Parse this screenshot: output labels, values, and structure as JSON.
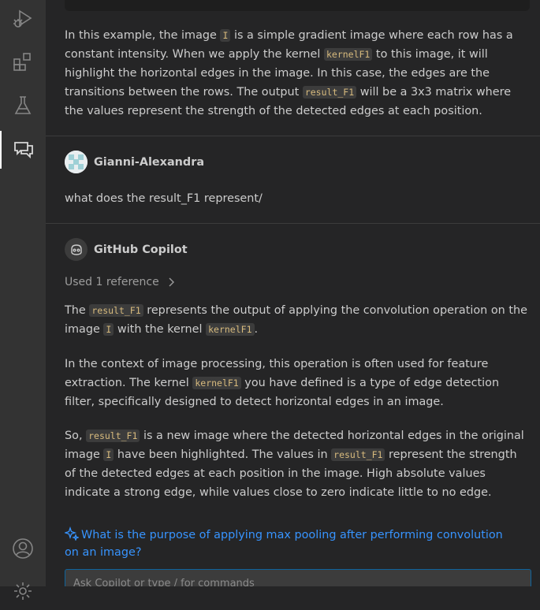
{
  "activity_bar": {
    "icons": [
      "run-debug-icon",
      "extensions-icon",
      "testing-icon",
      "chat-icon",
      "account-icon",
      "settings-icon"
    ]
  },
  "chat": {
    "prev_response": {
      "paragraph_parts": [
        "In this example, the image ",
        "I",
        " is a simple gradient image where each row has a constant intensity. When we apply the kernel ",
        "kernelF1",
        " to this image, it will highlight the horizontal edges in the image. In this case, the edges are the transitions between the rows. The output ",
        "result_F1",
        " will be a 3x3 matrix where the values represent the strength of the detected edges at each position."
      ]
    },
    "user_message": {
      "username": "Gianni-Alexandra",
      "text": "what does the result_F1 represent/"
    },
    "copilot_response": {
      "name": "GitHub Copilot",
      "reference_label": "Used 1 reference",
      "p1": [
        "The ",
        "result_F1",
        " represents the output of applying the convolution operation on the image ",
        "I",
        " with the kernel ",
        "kernelF1",
        "."
      ],
      "p2": [
        "In the context of image processing, this operation is often used for feature extraction. The kernel ",
        "kernelF1",
        " you have defined is a type of edge detection filter, specifically designed to detect horizontal edges in an image."
      ],
      "p3": [
        "So, ",
        "result_F1",
        " is a new image where the detected horizontal edges in the original image ",
        "I",
        " have been highlighted. The values in ",
        "result_F1",
        " represent the strength of the detected edges at each position in the image. High absolute values indicate a strong edge, while values close to zero indicate little to no edge."
      ]
    },
    "followup": "What is the purpose of applying max pooling after performing convolution on an image?",
    "input_placeholder": "Ask Copilot or type / for commands"
  },
  "colors": {
    "accent": "#3794ff",
    "code_text": "#d7ba7d",
    "background": "#252526",
    "activity_bar": "#333333"
  }
}
